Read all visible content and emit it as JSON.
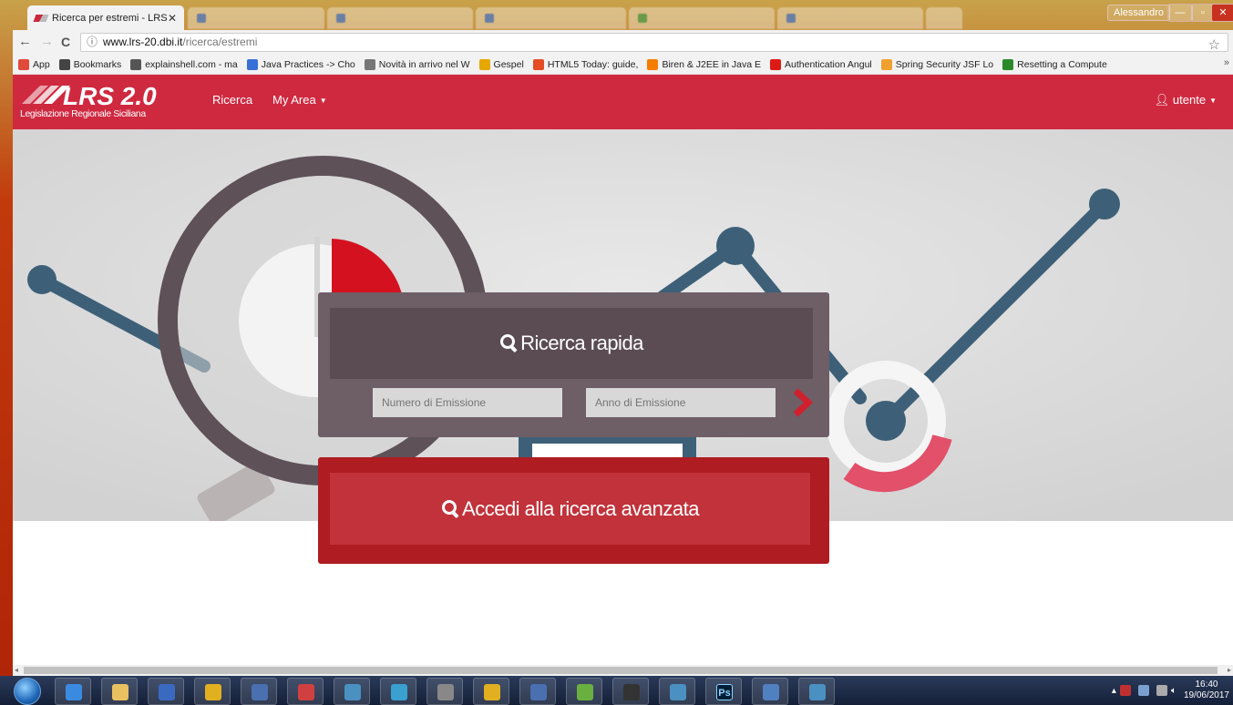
{
  "browser": {
    "active_tab": {
      "title": "Ricerca per estremi - LRS"
    },
    "window_user": "Alessandro",
    "address": {
      "info_icon": "info-icon",
      "host": "www.lrs-20.dbi.it",
      "path": "/ricerca/estremi"
    },
    "bookmarks": [
      {
        "label": "App",
        "icon": "apps-grid-icon",
        "color": "#e04a3a"
      },
      {
        "label": "Bookmarks",
        "icon": "star-icon",
        "color": "#444444"
      },
      {
        "label": "explainshell.com - ma",
        "icon": "shell-icon",
        "color": "#555555"
      },
      {
        "label": "Java Practices -> Cho",
        "icon": "java-icon",
        "color": "#3a6fd8"
      },
      {
        "label": "Novità in arrivo nel W",
        "icon": "hw-icon",
        "color": "#777777"
      },
      {
        "label": "Gespel",
        "icon": "gespel-icon",
        "color": "#e6a700"
      },
      {
        "label": "HTML5 Today: guide,",
        "icon": "html5-icon",
        "color": "#e44d26"
      },
      {
        "label": "Biren & J2EE in Java E",
        "icon": "blogger-icon",
        "color": "#f57d00"
      },
      {
        "label": "Authentication Angul",
        "icon": "angular-icon",
        "color": "#dd1b16"
      },
      {
        "label": "Spring Security JSF Lo",
        "icon": "spring-icon",
        "color": "#f0a030"
      },
      {
        "label": "Resetting a Compute",
        "icon": "reset-icon",
        "color": "#2a8a2a"
      }
    ],
    "more": "»"
  },
  "app": {
    "brand": {
      "name": "LRS 2.0",
      "subtitle": "Legislazione Regionale Siciliana"
    },
    "nav": {
      "ricerca": "Ricerca",
      "my_area": "My Area",
      "user": "utente"
    },
    "quick_search": {
      "title": "Ricerca rapida",
      "numero_placeholder": "Numero di Emissione",
      "anno_placeholder": "Anno di Emissione"
    },
    "advanced_search": {
      "label": "Accedi alla ricerca avanzata"
    }
  },
  "colors": {
    "primary": "#cf2940",
    "panel": "#6e5e66",
    "panel_dark": "#5b4c54",
    "advanced": "#af1c21"
  },
  "taskbar": {
    "items": [
      "ie-icon",
      "explorer-icon",
      "media-icon",
      "chrome-icon",
      "app-icon",
      "app-icon",
      "window-icon",
      "network-icon",
      "search-icon",
      "chrome-icon",
      "app-icon",
      "evernote-icon",
      "terminal-icon",
      "window-icon",
      "photoshop-icon",
      "app-icon",
      "window-icon"
    ],
    "photoshop_label": "Ps",
    "time": "16:40",
    "date": "19/06/2017"
  }
}
